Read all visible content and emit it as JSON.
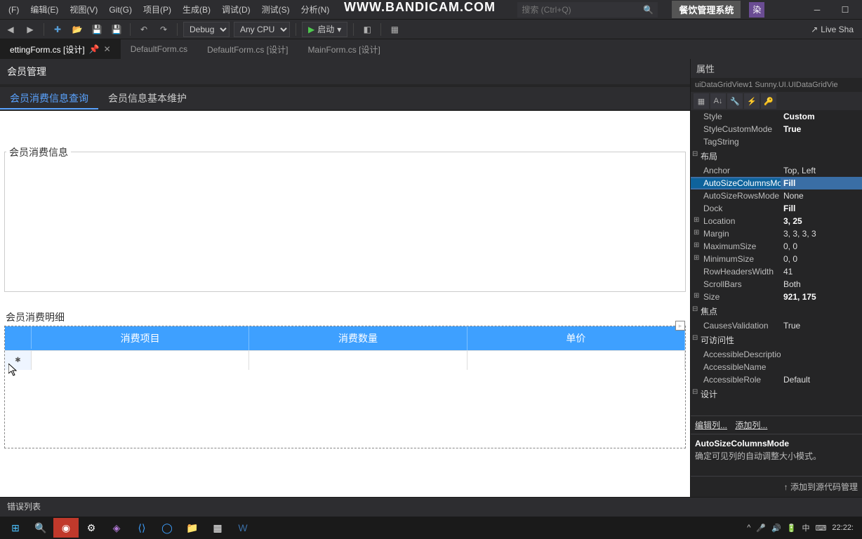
{
  "menu": {
    "file": "(F)",
    "edit": "编辑(E)",
    "view": "视图(V)",
    "git": "Git(G)",
    "project": "项目(P)",
    "build": "生成(B)",
    "debug": "调试(D)",
    "test": "测试(S)",
    "analyze": "分析(N)"
  },
  "watermark": "WWW.BANDICAM.COM",
  "search": {
    "placeholder": "搜索 (Ctrl+Q)"
  },
  "solution_name": "餐饮管理系统",
  "avatar": "染",
  "toolbar": {
    "config": "Debug",
    "platform": "Any CPU",
    "start": "启动",
    "liveshare": "Live Sha"
  },
  "tabs": [
    {
      "label": "ettingForm.cs [设计]",
      "active": true
    },
    {
      "label": "DefaultForm.cs",
      "active": false
    },
    {
      "label": "DefaultForm.cs [设计]",
      "active": false
    },
    {
      "label": "MainForm.cs [设计]",
      "active": false
    }
  ],
  "form": {
    "title": "会员管理",
    "inner_tabs": [
      {
        "label": "会员消费信息查询",
        "active": true
      },
      {
        "label": "会员信息基本维护",
        "active": false
      }
    ],
    "group1_title": "会员消费信息",
    "group2_title": "会员消费明细",
    "grid_columns": [
      "消费项目",
      "消费数量",
      "单价"
    ]
  },
  "properties": {
    "panel_title": "属性",
    "object": "uiDataGridView1  Sunny.UI.UIDataGridVie",
    "rows": [
      {
        "name": "Style",
        "value": "Custom",
        "bold": true
      },
      {
        "name": "StyleCustomMode",
        "value": "True",
        "bold": true
      },
      {
        "name": "TagString",
        "value": ""
      }
    ],
    "cat_layout": "布局",
    "layout_rows": [
      {
        "name": "Anchor",
        "value": "Top, Left"
      },
      {
        "name": "AutoSizeColumnsMode",
        "value": "Fill",
        "bold": true,
        "selected": true
      },
      {
        "name": "AutoSizeRowsMode",
        "value": "None"
      },
      {
        "name": "Dock",
        "value": "Fill",
        "bold": true
      },
      {
        "name": "Location",
        "value": "3, 25",
        "bold": true,
        "expand": true
      },
      {
        "name": "Margin",
        "value": "3, 3, 3, 3",
        "expand": true
      },
      {
        "name": "MaximumSize",
        "value": "0, 0",
        "expand": true
      },
      {
        "name": "MinimumSize",
        "value": "0, 0",
        "expand": true
      },
      {
        "name": "RowHeadersWidth",
        "value": "41"
      },
      {
        "name": "ScrollBars",
        "value": "Both"
      },
      {
        "name": "Size",
        "value": "921, 175",
        "bold": true,
        "expand": true
      }
    ],
    "cat_focus": "焦点",
    "focus_rows": [
      {
        "name": "CausesValidation",
        "value": "True"
      }
    ],
    "cat_access": "可访问性",
    "access_rows": [
      {
        "name": "AccessibleDescription",
        "value": ""
      },
      {
        "name": "AccessibleName",
        "value": ""
      },
      {
        "name": "AccessibleRole",
        "value": "Default"
      }
    ],
    "cat_design": "设计",
    "link_edit": "编辑列...",
    "link_add": "添加列...",
    "desc_title": "AutoSizeColumnsMode",
    "desc_text": "确定可见列的自动调整大小模式。",
    "footer_link": "↑ 添加到源代码管理"
  },
  "errorlist": "错误列表",
  "taskbar": {
    "ime": "中",
    "time": "22:22:"
  }
}
